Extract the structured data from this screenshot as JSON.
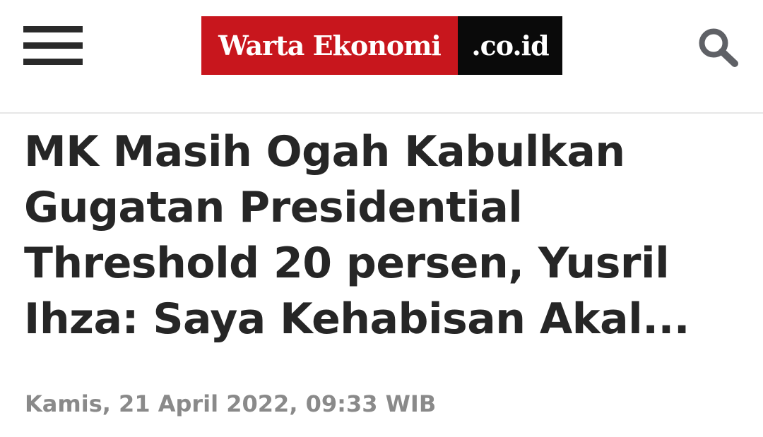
{
  "header": {
    "menu_icon": "hamburger-menu-icon",
    "logo": {
      "main_text": "Warta Ekonomi",
      "suffix_text": ".co.id",
      "main_color": "#c8161d",
      "suffix_color": "#0a0a0a"
    },
    "search_icon": "search-icon"
  },
  "article": {
    "title": "MK Masih Ogah Kabulkan Gugatan Presidential Threshold 20 persen, Yusril Ihza: Saya Kehabisan Akal...",
    "timestamp": "Kamis, 21 April 2022, 09:33 WIB"
  },
  "colors": {
    "headline": "#262626",
    "meta": "#8a8a8a",
    "icon": "#2a2a2a"
  }
}
